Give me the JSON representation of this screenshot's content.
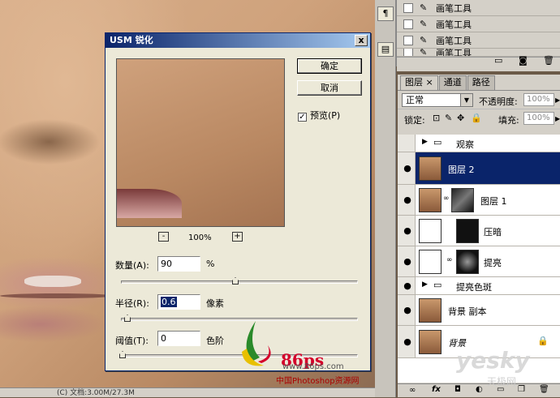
{
  "dialog": {
    "title": "USM 锐化",
    "ok_label": "确定",
    "cancel_label": "取消",
    "preview_label": "预览(P)",
    "preview_checked": true,
    "zoom_minus": "-",
    "zoom_plus": "+",
    "zoom_level": "100%",
    "amount_label": "数量(A):",
    "amount_value": "90",
    "amount_unit": "%",
    "radius_label": "半径(R):",
    "radius_value": "0.6",
    "radius_unit": "像素",
    "threshold_label": "阈值(T):",
    "threshold_value": "0",
    "threshold_unit": "色阶",
    "close_glyph": "x"
  },
  "history": {
    "items": [
      {
        "label": "画笔工具"
      },
      {
        "label": "画笔工具"
      },
      {
        "label": "画笔工具"
      },
      {
        "label": "画笔工具"
      }
    ]
  },
  "layers_panel": {
    "tabs": [
      {
        "label": "图层 ×",
        "active": true
      },
      {
        "label": "通道",
        "active": false
      },
      {
        "label": "路径",
        "active": false
      }
    ],
    "blend_mode": "正常",
    "opacity_label": "不透明度:",
    "opacity_value": "100%",
    "lock_label": "锁定:",
    "fill_label": "填充:",
    "fill_value": "100%",
    "layers": [
      {
        "name": "观察",
        "type": "group",
        "visible": false
      },
      {
        "name": "图层 2",
        "type": "image",
        "visible": true,
        "selected": true
      },
      {
        "name": "图层 1",
        "type": "image-mask",
        "visible": true
      },
      {
        "name": "压暗",
        "type": "curves-mask",
        "visible": true
      },
      {
        "name": "提亮",
        "type": "curves-mask",
        "visible": true
      },
      {
        "name": "提亮色斑",
        "type": "group",
        "visible": true
      },
      {
        "name": "背景 副本",
        "type": "image",
        "visible": true
      },
      {
        "name": "背景",
        "type": "image-locked",
        "visible": true
      }
    ],
    "footer_icons": [
      "link-icon",
      "fx-icon",
      "mask-icon",
      "adjustment-icon",
      "folder-icon",
      "new-layer-icon",
      "trash-icon"
    ]
  },
  "status": {
    "doc_text": "(C) 文档:3.00M/27.3M"
  },
  "watermarks": {
    "site_86": "86ps",
    "url": "www.86ps.com",
    "cn_name": "中国Photoshop资源网",
    "yesky": "yesky",
    "yesky_cn": "天极网"
  },
  "colors": {
    "titlebar": "#0a246a",
    "selected_layer": "#0a246a",
    "dialog_bg": "#ece9d8"
  }
}
